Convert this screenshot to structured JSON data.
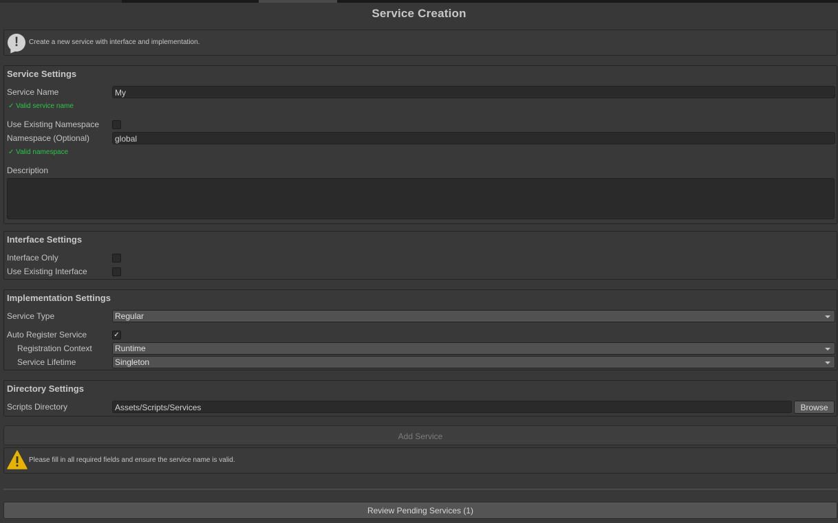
{
  "window": {
    "title": "Service Creation"
  },
  "help": {
    "info_text": "Create a new service with interface and implementation."
  },
  "service_settings": {
    "heading": "Service Settings",
    "name_label": "Service Name",
    "name_value": "My",
    "name_valid": "✓ Valid service name",
    "use_existing_ns_label": "Use Existing Namespace",
    "use_existing_ns_checked": false,
    "namespace_label": "Namespace (Optional)",
    "namespace_value": "global",
    "namespace_valid": "✓ Valid namespace",
    "description_label": "Description",
    "description_value": ""
  },
  "interface_settings": {
    "heading": "Interface Settings",
    "interface_only_label": "Interface Only",
    "interface_only_checked": false,
    "use_existing_interface_label": "Use Existing Interface",
    "use_existing_interface_checked": false
  },
  "implementation_settings": {
    "heading": "Implementation Settings",
    "service_type_label": "Service Type",
    "service_type_value": "Regular",
    "auto_register_label": "Auto Register Service",
    "auto_register_checked": true,
    "auto_register_mark": "✓",
    "registration_context_label": "Registration Context",
    "registration_context_value": "Runtime",
    "service_lifetime_label": "Service Lifetime",
    "service_lifetime_value": "Singleton"
  },
  "directory_settings": {
    "heading": "Directory Settings",
    "scripts_dir_label": "Scripts Directory",
    "scripts_dir_value": "Assets/Scripts/Services",
    "browse_label": "Browse"
  },
  "actions": {
    "add_service_label": "Add Service",
    "add_service_enabled": false,
    "warning_text": "Please fill in all required fields and ensure the service name is valid.",
    "review_label": "Review Pending Services (1)"
  },
  "icons": {
    "info": "info-icon",
    "warning": "warning-icon",
    "dropdown": "chevron-down-icon"
  },
  "colors": {
    "valid": "#2ec44a",
    "warning": "#e6b400"
  }
}
